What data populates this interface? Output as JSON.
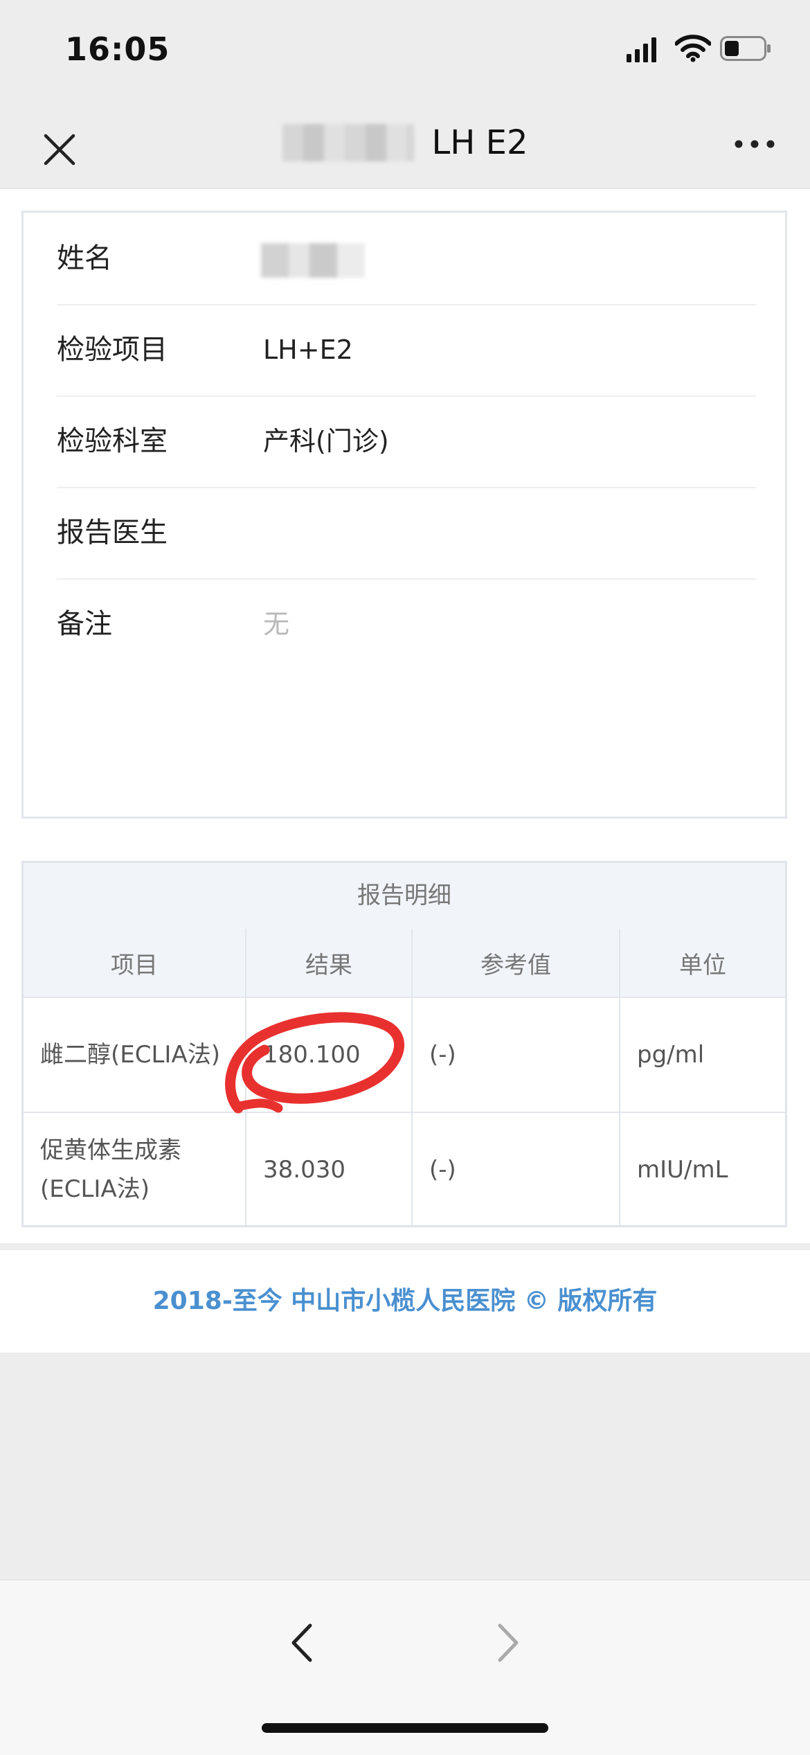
{
  "status_bar": {
    "time": "16:05"
  },
  "nav": {
    "title_suffix": "LH E2"
  },
  "info": {
    "rows": [
      {
        "label": "姓名",
        "value": ""
      },
      {
        "label": "检验项目",
        "value": "LH+E2"
      },
      {
        "label": "检验科室",
        "value": "产科(门诊)"
      },
      {
        "label": "报告医生",
        "value": ""
      },
      {
        "label": "备注",
        "value": "无"
      }
    ]
  },
  "report": {
    "title": "报告明细",
    "headers": [
      "项目",
      "结果",
      "参考值",
      "单位"
    ],
    "rows": [
      {
        "item": "雌二醇(ECLIA法)",
        "result": "180.100",
        "reference": "(-)",
        "unit": "pg/ml"
      },
      {
        "item": "促黄体生成素(ECLIA法)",
        "result": "38.030",
        "reference": "(-)",
        "unit": "mIU/mL"
      }
    ]
  },
  "footer": {
    "text": "2018-至今 中山市小榄人民医院 © 版权所有"
  },
  "colors": {
    "footer_link": "#4a90d0",
    "annotation": "#e8312f"
  }
}
